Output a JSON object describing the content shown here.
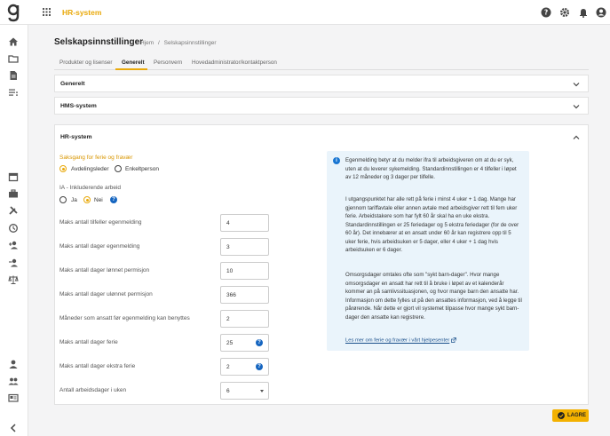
{
  "app": {
    "title": "HR-system",
    "brand_color": "#e9a90b"
  },
  "header": {
    "title": "Selskapsinnstillinger",
    "breadcrumb": [
      "Hjem",
      "/",
      "Selskapsinnstillinger"
    ]
  },
  "tabs": [
    {
      "label": "Produkter og lisenser",
      "active": false
    },
    {
      "label": "Generelt",
      "active": true
    },
    {
      "label": "Personvern",
      "active": false
    },
    {
      "label": "Hovedadministrator/kontaktperson",
      "active": false
    }
  ],
  "panels": {
    "generelt": {
      "title": "Generelt",
      "expanded": false
    },
    "hms": {
      "title": "HMS-system",
      "expanded": false
    },
    "hr": {
      "title": "HR-system",
      "expanded": true
    }
  },
  "hr": {
    "saksgang_label": "Saksgang for ferie og fravær",
    "saksgang_options": [
      {
        "label": "Avdelingsleder",
        "selected": true
      },
      {
        "label": "Enkeltperson",
        "selected": false
      }
    ],
    "ia_label": "IA - Inkluderende arbeid",
    "ia_options": [
      {
        "label": "Ja",
        "selected": false
      },
      {
        "label": "Nei",
        "selected": true
      }
    ],
    "fields": [
      {
        "label": "Maks antall tilfeller egenmelding",
        "value": "4"
      },
      {
        "label": "Maks antall dager egenmelding",
        "value": "3"
      },
      {
        "label": "Maks antall dager lønnet permisjon",
        "value": "10"
      },
      {
        "label": "Maks antall dager ulønnet permisjon",
        "value": "366"
      },
      {
        "label": "Måneder som ansatt før egenmelding kan benyttes",
        "value": "2"
      },
      {
        "label": "Maks antall dager ferie",
        "value": "25"
      },
      {
        "label": "Maks antall dager ekstra ferie",
        "value": "2"
      },
      {
        "label": "Antall arbeidsdager i uken",
        "value": "6"
      }
    ]
  },
  "info": {
    "p1": "Egenmelding betyr at du melder ifra til arbeidsgiveren om at du er syk, uten at du leverer sykemelding. Standardinnstillingen er 4 tilfeller i løpet av 12 måneder og 3 dager per tilfelle.",
    "p2": "I utgangspunktet har alle rett på ferie i minst 4 uker + 1 dag. Mange har gjennom tariffavtale eller annen avtale med arbeidsgiver rett til fem uker ferie. Arbeidstakere som har fylt 60 år skal ha en uke ekstra. Standardinnstillingen er 25 feriedager og 5 ekstra feriedager (for de over 60 år). Det innebærer at en ansatt under 60 år kan registrere opp til 5 uker ferie, hvis arbeidsuken er 5 dager, eller 4 uker + 1 dag hvis arbeidsuken er 6 dager.",
    "p3": "Omsorgsdager omtales ofte som \"sykt barn-dager\". Hvor mange omsorgsdager en ansatt har rett til å bruke i løpet av et kalenderår kommer an på samlivssituasjonen, og hvor mange barn den ansatte har. Informasjon om dette fylles ut på den ansattes informasjon, ved å legge til pårørende. Når dette er gjort vil systemet tilpasse hvor mange sykt barn-dager den ansatte kan registrere.",
    "link": "Les mer om ferie og fravær i vårt hjelpesenter"
  },
  "save_label": "LAGRE",
  "icons": {
    "top": [
      "help-icon",
      "gear-icon",
      "bell-icon",
      "account-icon"
    ],
    "sidebar": [
      "home-icon",
      "folder-icon",
      "document-icon",
      "list-icon",
      "calendar-icon",
      "briefcase-icon",
      "tools-icon",
      "history-icon",
      "person-add-icon",
      "person-remove-icon",
      "scale-icon",
      "person-icon",
      "people-icon",
      "id-card-icon",
      "collapse-icon"
    ]
  }
}
